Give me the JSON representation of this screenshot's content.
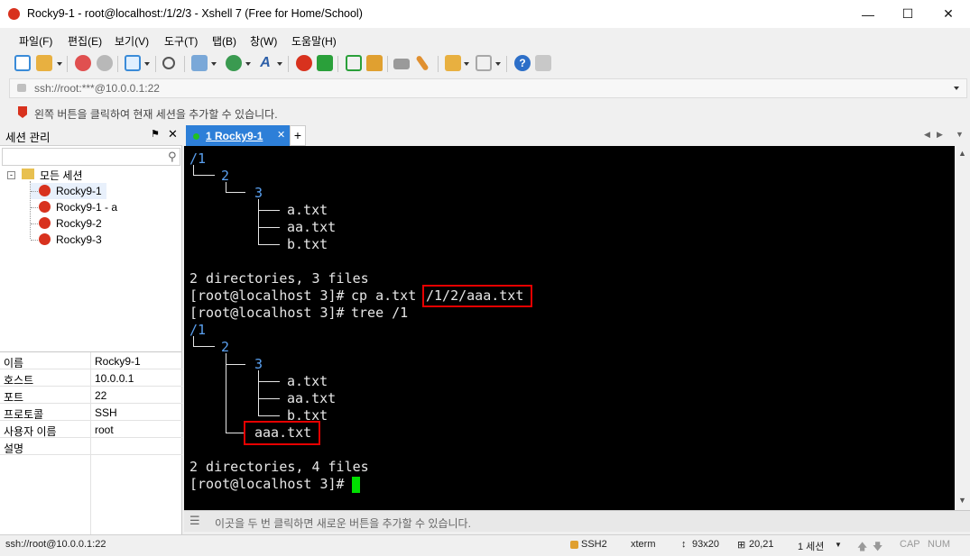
{
  "window": {
    "title": "Rocky9-1 - root@localhost:/1/2/3 - Xshell 7 (Free for Home/School)"
  },
  "menu": [
    "파일(F)",
    "편집(E)",
    "보기(V)",
    "도구(T)",
    "탭(B)",
    "창(W)",
    "도움말(H)"
  ],
  "address": {
    "value": "ssh://root:***@10.0.0.1:22"
  },
  "hint": {
    "text": "왼쪽 버튼을 클릭하여 현재 세션을 추가할 수 있습니다."
  },
  "sessions": {
    "title": "세션 관리",
    "root": "모든 세션",
    "items": [
      "Rocky9-1",
      "Rocky9-1 - a",
      "Rocky9-2",
      "Rocky9-3"
    ],
    "selected": "Rocky9-1"
  },
  "properties": [
    {
      "key": "이름",
      "value": "Rocky9-1"
    },
    {
      "key": "호스트",
      "value": "10.0.0.1"
    },
    {
      "key": "포트",
      "value": "22"
    },
    {
      "key": "프로토콜",
      "value": "SSH"
    },
    {
      "key": "사용자 이름",
      "value": "root"
    },
    {
      "key": "설명",
      "value": ""
    }
  ],
  "tab": {
    "label": "1 Rocky9-1",
    "status_color": "#22c022"
  },
  "terminal": {
    "tree1": {
      "root": "/1",
      "dir2": "2",
      "dir3": "3",
      "files": [
        "a.txt",
        "aa.txt",
        "b.txt"
      ]
    },
    "summary1": "2 directories, 3 files",
    "prompt": "[root@localhost 3]#",
    "cmd1": "cp a.txt",
    "cmd1_arg": "/1/2/aaa.txt",
    "cmd2": "tree /1",
    "tree2": {
      "root": "/1",
      "dir2": "2",
      "dir3": "3",
      "files": [
        "a.txt",
        "aa.txt",
        "b.txt"
      ],
      "new_file": "aaa.txt"
    },
    "summary2": "2 directories, 4 files",
    "highlight_color": "#e60000",
    "dir_color": "#5aa0f0",
    "cursor_color": "#00e000"
  },
  "compose": {
    "text": "이곳을 두 번 클릭하면 새로운 버튼을 추가할 수 있습니다."
  },
  "status": {
    "connection": "ssh://root@10.0.0.1:22",
    "protocol": "SSH2",
    "term": "xterm",
    "size": "93x20",
    "cursor": "20,21",
    "sessions": "1 세션",
    "cap": "CAP",
    "num": "NUM"
  }
}
